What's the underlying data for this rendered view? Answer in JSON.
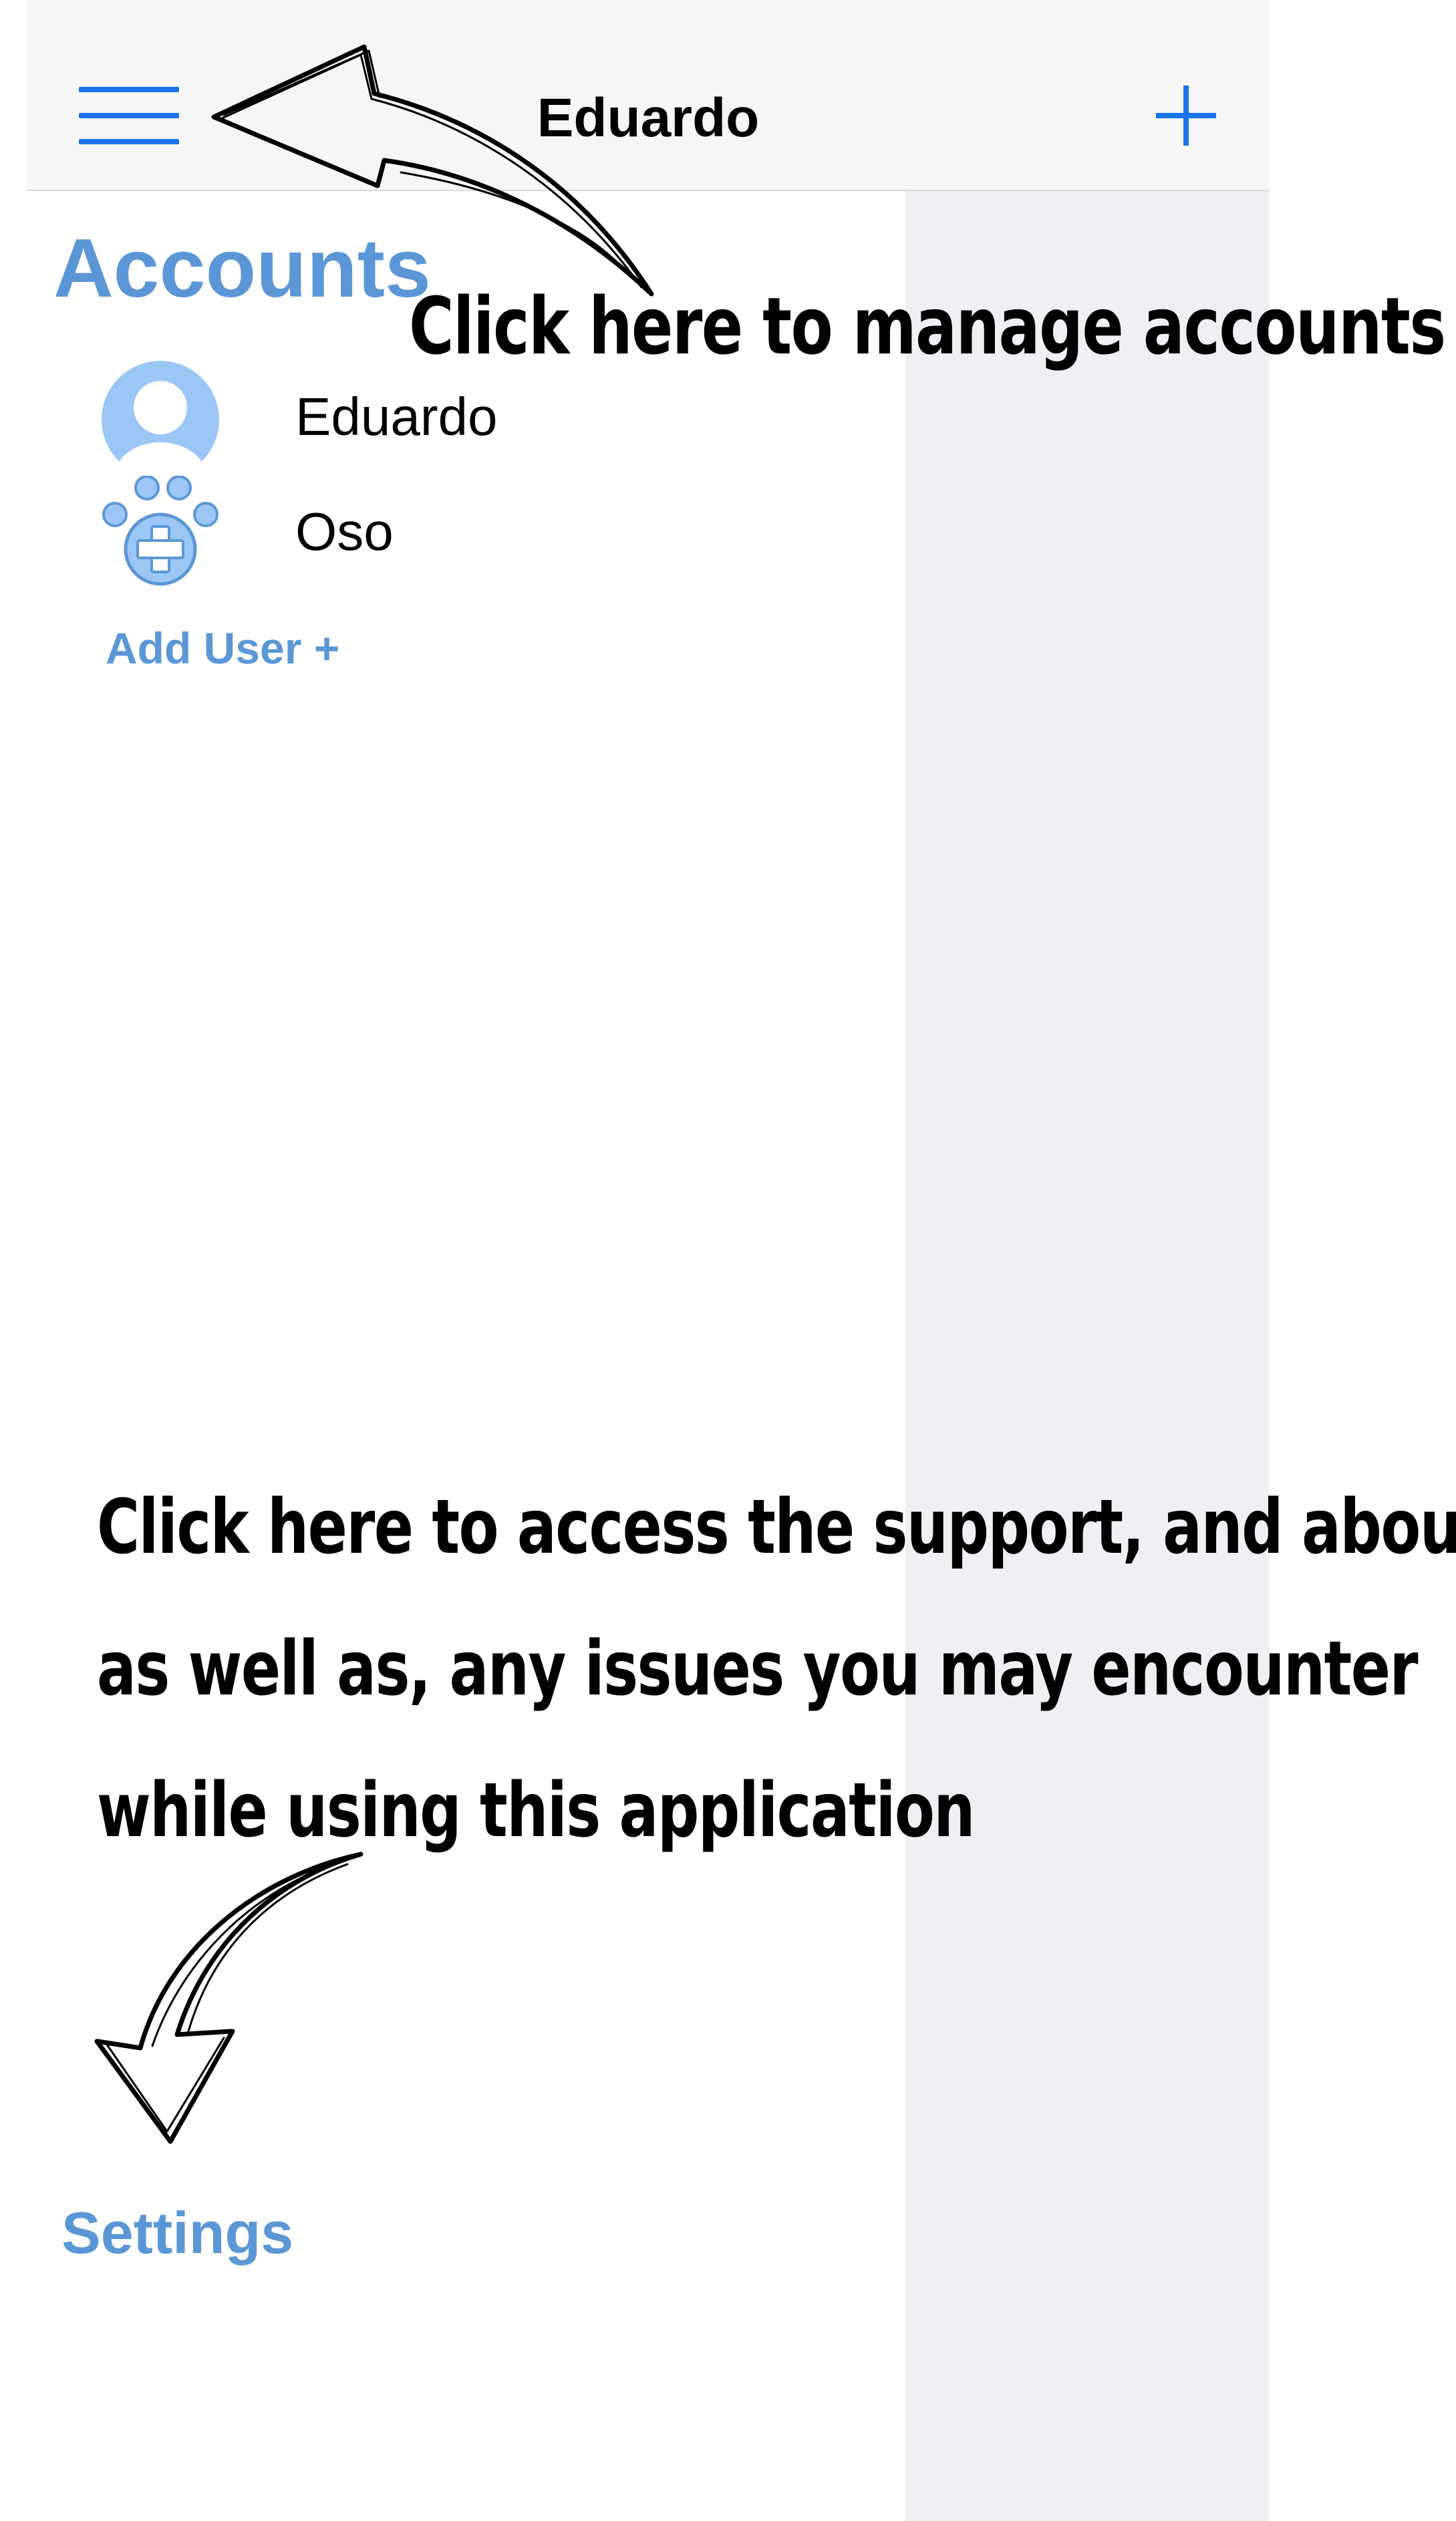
{
  "navbar": {
    "title": "Eduardo",
    "menu_icon": "hamburger-menu-icon",
    "add_icon": "plus-icon",
    "accent_color": "#1a74e8"
  },
  "drawer": {
    "heading": "Accounts",
    "accounts": [
      {
        "label": "Eduardo",
        "icon": "person-avatar-icon"
      },
      {
        "label": "Oso",
        "icon": "paw-plus-icon"
      }
    ],
    "add_user_label": "Add User +",
    "settings_label": "Settings",
    "link_color": "#5b97d6"
  },
  "annotations": {
    "top": "Click here to manage accounts",
    "bottom": [
      "Click here to access the support, and about page,",
      "as well as, any issues you may encounter",
      "while using this application"
    ]
  }
}
